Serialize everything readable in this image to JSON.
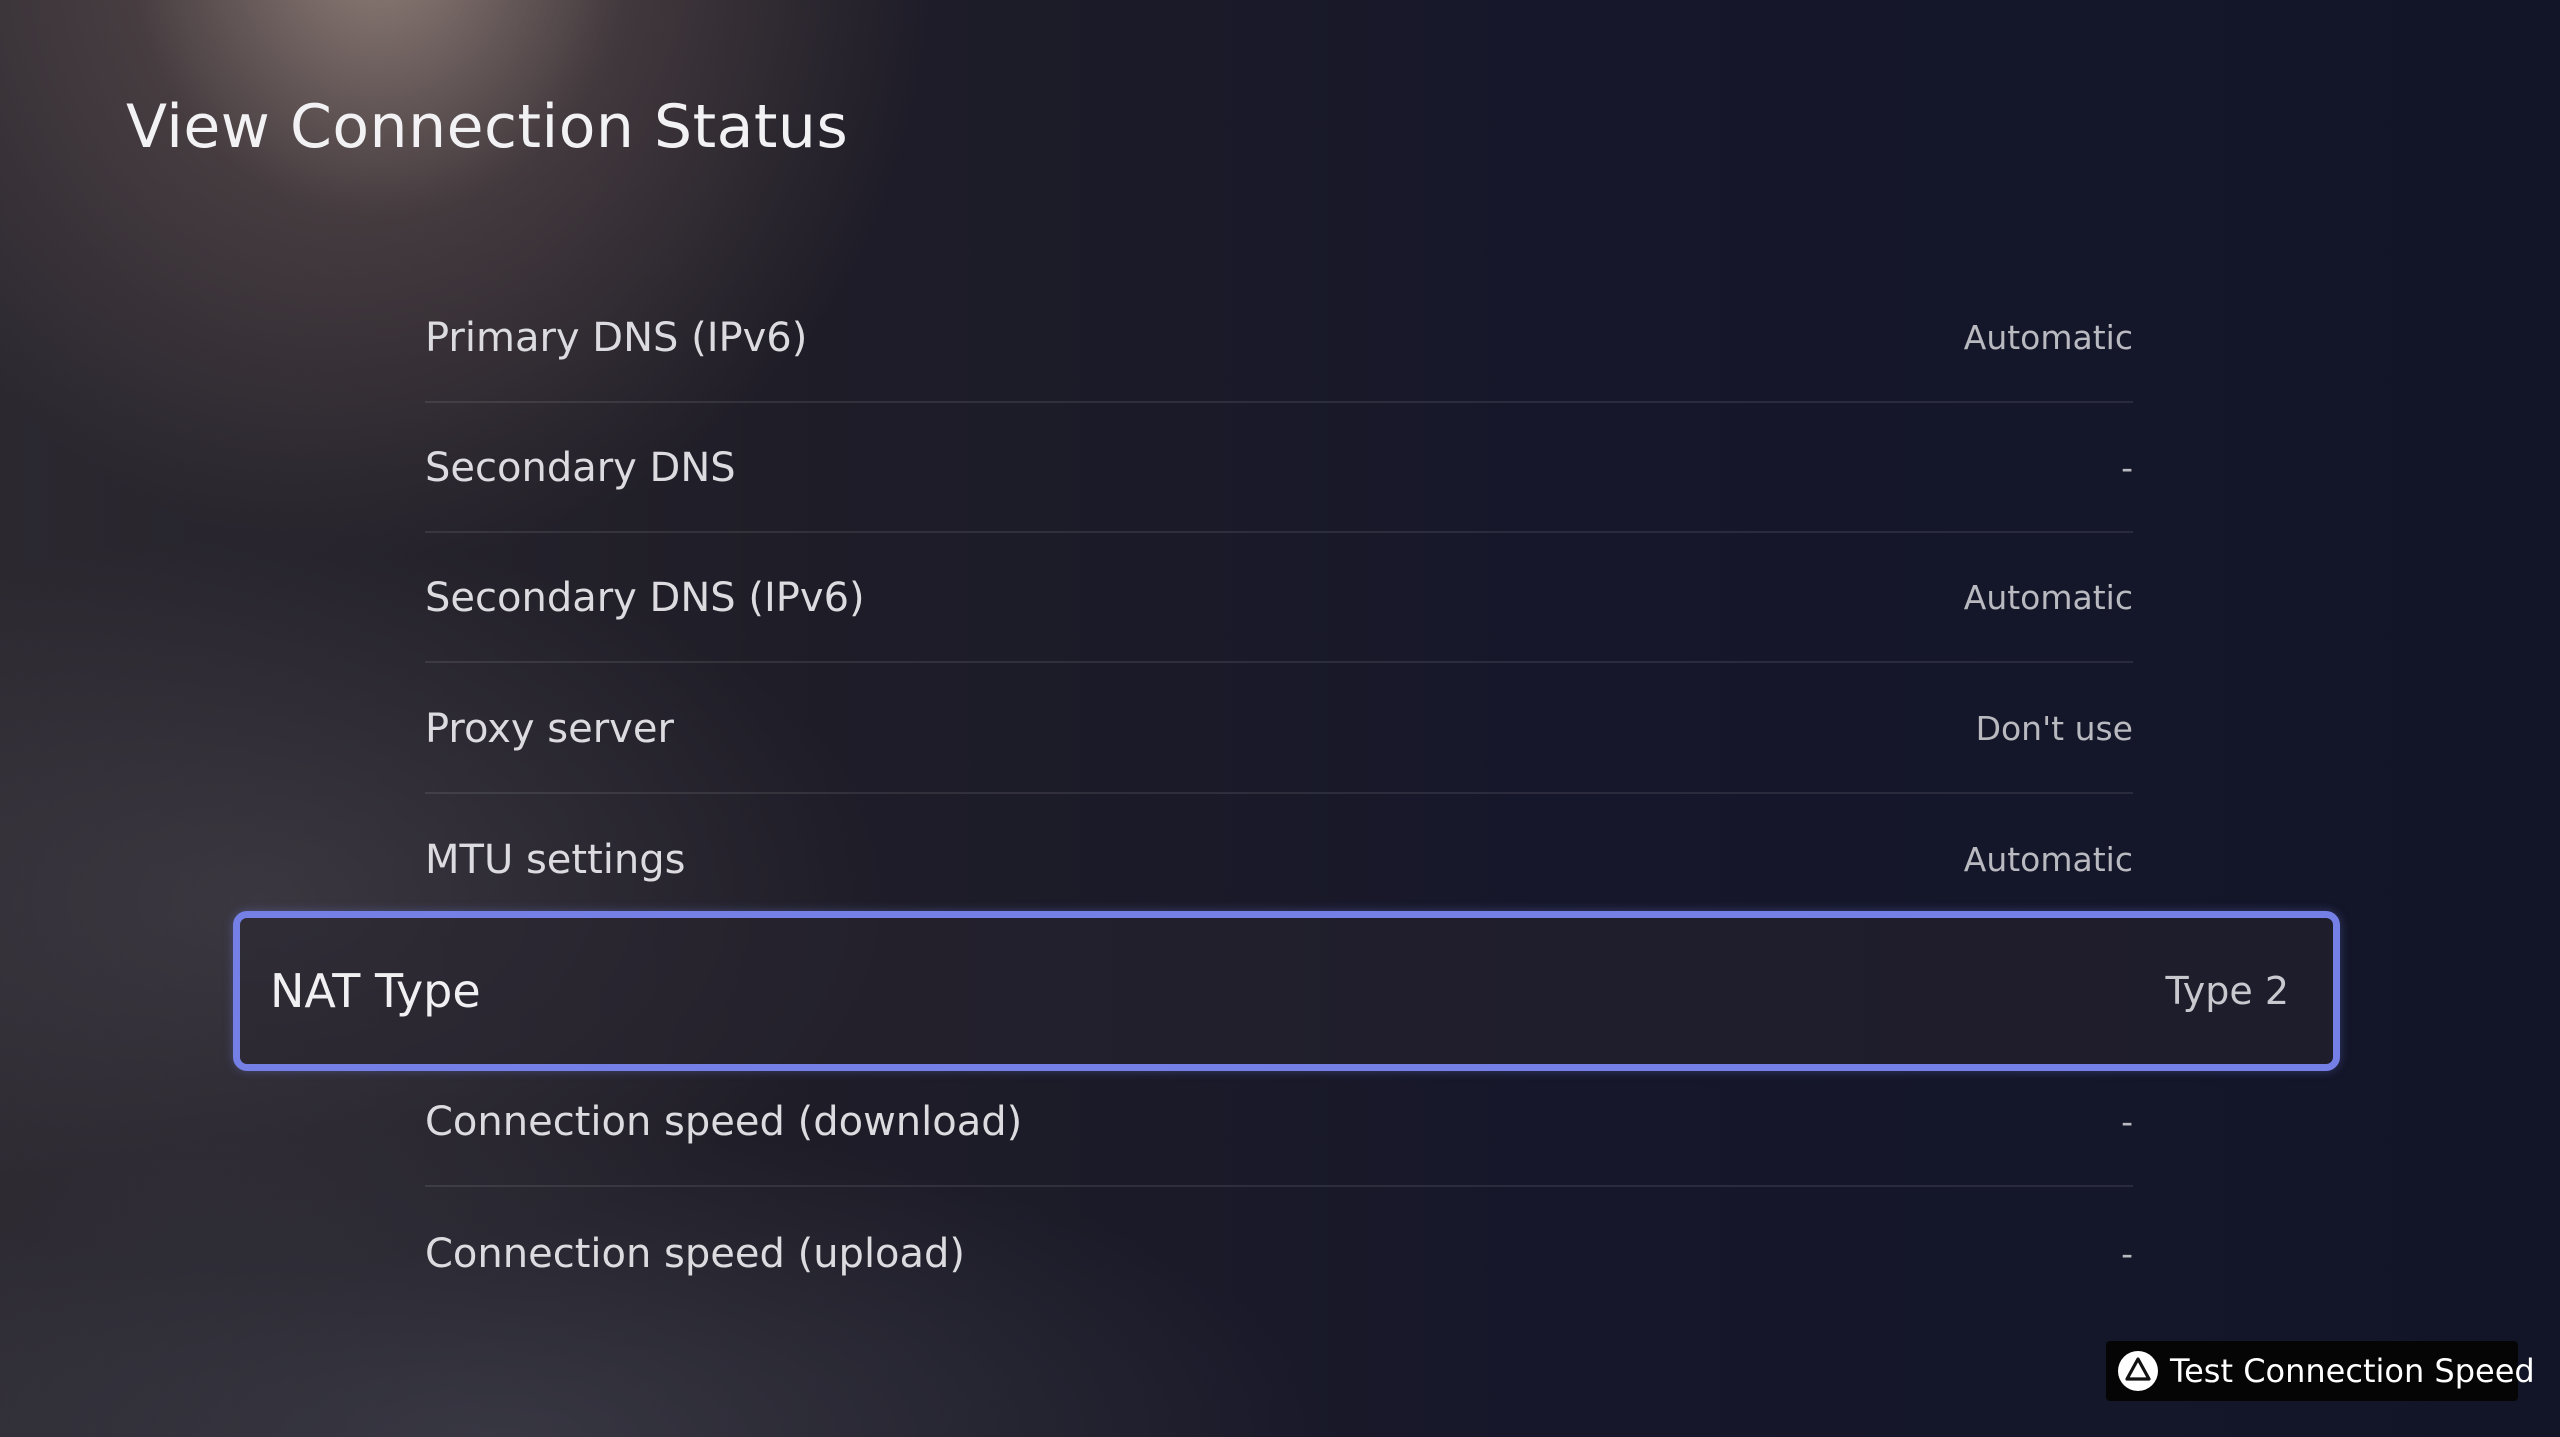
{
  "header": {
    "title": "View Connection Status"
  },
  "settings": {
    "items": [
      {
        "label": "Primary DNS (IPv6)",
        "value": "Automatic"
      },
      {
        "label": "Secondary DNS",
        "value": "-"
      },
      {
        "label": "Secondary DNS (IPv6)",
        "value": "Automatic"
      },
      {
        "label": "Proxy server",
        "value": "Don't use"
      },
      {
        "label": "MTU settings",
        "value": "Automatic"
      },
      {
        "label": "NAT Type",
        "value": "Type 2",
        "selected": true
      },
      {
        "label": "Connection speed (download)",
        "value": "-"
      },
      {
        "label": "Connection speed (upload)",
        "value": "-"
      }
    ]
  },
  "footer": {
    "action_icon": "triangle-button-icon",
    "action_label": "Test Connection Speed"
  },
  "colors": {
    "focus_ring": "#7480e6",
    "background": "#16172a"
  }
}
